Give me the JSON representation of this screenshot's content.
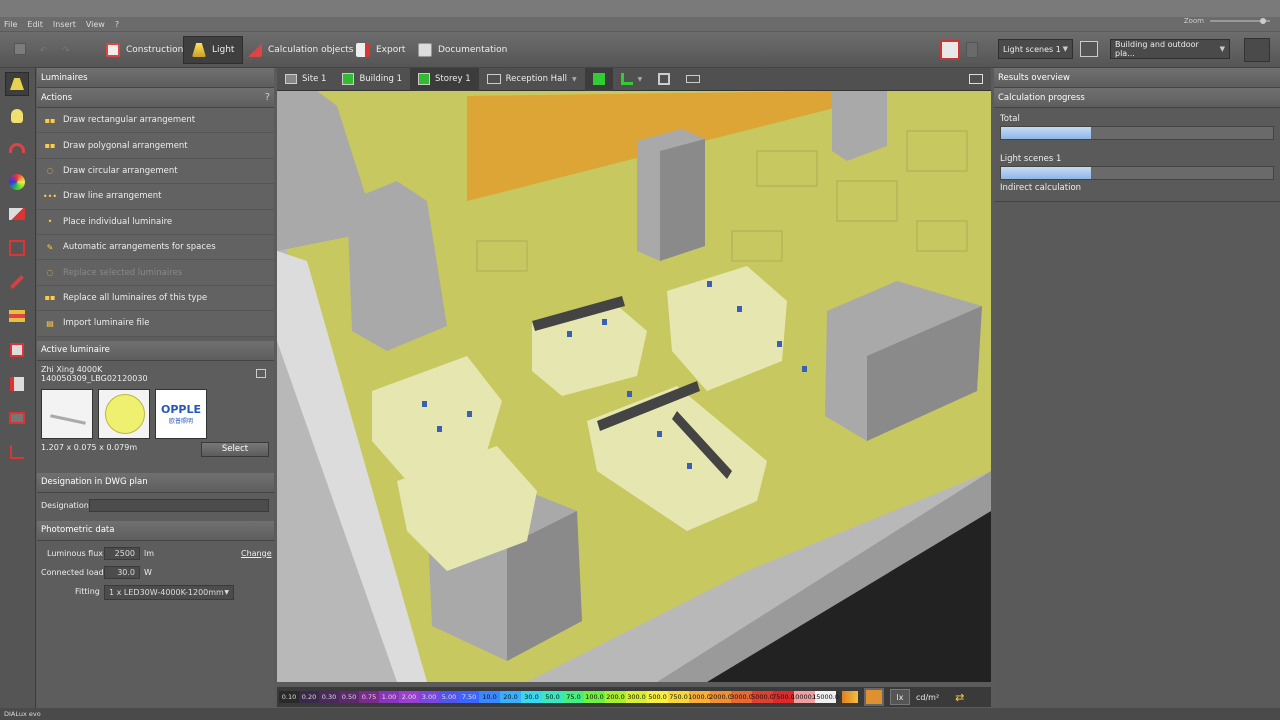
{
  "menu": [
    "File",
    "Edit",
    "Insert",
    "View",
    "?"
  ],
  "zoom_label": "Zoom",
  "toolbar": {
    "construction": "Construction",
    "light": "Light",
    "calc_objects": "Calculation objects",
    "export": "Export",
    "documentation": "Documentation",
    "light_scenes": "Light scenes 1",
    "building_select": "Building and outdoor pla..."
  },
  "view_tabs": {
    "site": "Site 1",
    "building": "Building 1",
    "storey": "Storey 1",
    "room": "Reception Hall"
  },
  "panel": {
    "title": "Luminaires",
    "actions_header": "Actions",
    "help": "?",
    "actions": [
      {
        "label": "Draw rectangular arrangement",
        "dim": false
      },
      {
        "label": "Draw polygonal arrangement",
        "dim": false
      },
      {
        "label": "Draw circular arrangement",
        "dim": false
      },
      {
        "label": "Draw line arrangement",
        "dim": false
      },
      {
        "label": "Place individual luminaire",
        "dim": false
      },
      {
        "label": "Automatic arrangements for spaces",
        "dim": false
      },
      {
        "label": "Replace selected luminaires",
        "dim": true
      },
      {
        "label": "Replace all luminaires of this type",
        "dim": false
      },
      {
        "label": "Import luminaire file",
        "dim": false
      }
    ],
    "active_header": "Active luminaire",
    "lum_name": "Zhi Xing 4000K",
    "lum_code": "140050309_LBG02120030",
    "brand": "OPPLE",
    "brand_sub": "欧普照明",
    "dimensions": "1.207 x 0.075 x 0.079m",
    "select": "Select",
    "dwg_header": "Designation in DWG plan",
    "designation_label": "Designation",
    "designation_value": "",
    "photo_header": "Photometric data",
    "flux_label": "Luminous flux",
    "flux_value": "2500",
    "flux_unit": "lm",
    "change": "Change",
    "load_label": "Connected load",
    "load_value": "30.0",
    "load_unit": "W",
    "fitting_label": "Fitting",
    "fitting_value": "1 x LED30W-4000K-1200mm"
  },
  "results": {
    "header": "Results overview",
    "progress_header": "Calculation progress",
    "total_label": "Total",
    "total_progress": 0.33,
    "scene_label": "Light scenes 1",
    "scene_progress": 0.33,
    "indirect_label": "Indirect calculation"
  },
  "scale": {
    "values": [
      "0.10",
      "0.20",
      "0.30",
      "0.50",
      "0.75",
      "1.00",
      "2.00",
      "3.00",
      "5.00",
      "7.50",
      "10.0",
      "20.0",
      "30.0",
      "50.0",
      "75.0",
      "100.0",
      "200.0",
      "300.0",
      "500.0",
      "750.0",
      "1000.0",
      "2000.0",
      "3000.0",
      "5000.0",
      "7500.0",
      "10000.0",
      "15000.0"
    ],
    "colors": [
      "#2a2a2a",
      "#3a2a4a",
      "#4a2a5a",
      "#5a2a6a",
      "#7a2a8a",
      "#8a33bb",
      "#9a3fd0",
      "#7a46e0",
      "#5055ee",
      "#3a66ff",
      "#3a88ff",
      "#38b0ff",
      "#38d8f0",
      "#38e8c0",
      "#44ee80",
      "#70f040",
      "#a8f030",
      "#d8f030",
      "#f8f040",
      "#f8d838",
      "#f8b038",
      "#f09030",
      "#e86a30",
      "#e04030",
      "#e02a2a",
      "#f0a0a0",
      "#f0f0f0"
    ],
    "unit_lx": "lx",
    "unit_cd": "cd/m²"
  },
  "status": "DIALux evo"
}
